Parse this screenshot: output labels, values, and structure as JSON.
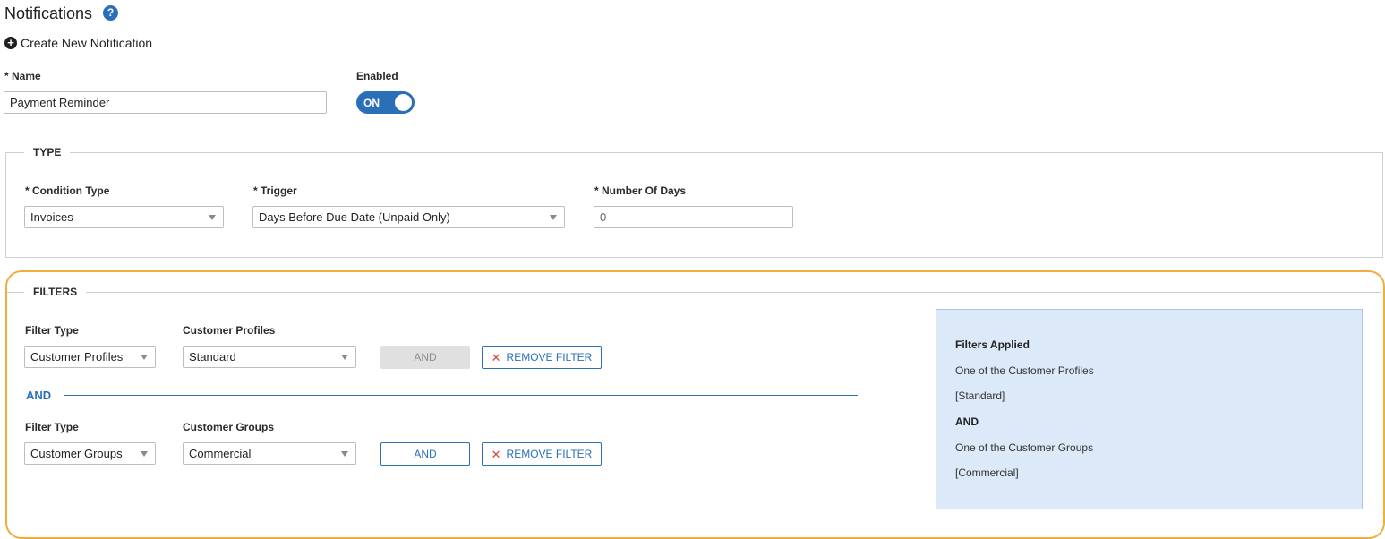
{
  "header": {
    "title": "Notifications",
    "help_icon": "?",
    "create_label": "Create New Notification"
  },
  "form": {
    "name_label": "* Name",
    "name_value": "Payment Reminder",
    "enabled_label": "Enabled",
    "enabled_state": "ON"
  },
  "type_section": {
    "legend": "TYPE",
    "condition_type_label": "* Condition Type",
    "condition_type_value": "Invoices",
    "trigger_label": "* Trigger",
    "trigger_value": "Days Before Due Date (Unpaid Only)",
    "days_label": "* Number Of Days",
    "days_value": "0"
  },
  "filters_section": {
    "legend": "FILTERS",
    "filters": [
      {
        "type_label": "Filter Type",
        "type_value": "Customer Profiles",
        "value_label": "Customer Profiles",
        "value": "Standard",
        "and_button": "AND",
        "remove_button": "REMOVE FILTER"
      },
      {
        "type_label": "Filter Type",
        "type_value": "Customer Groups",
        "value_label": "Customer Groups",
        "value": "Commercial",
        "and_button": "AND",
        "remove_button": "REMOVE FILTER"
      }
    ],
    "and_separator": "AND",
    "summary": {
      "title": "Filters Applied",
      "lines": [
        "One of the Customer Profiles",
        "[Standard]",
        "AND",
        "One of the Customer Groups",
        "[Commercial]"
      ]
    }
  },
  "colors": {
    "accent": "#2b6fb8",
    "highlight_border": "#f0ad3c",
    "summary_bg": "#dce9f8",
    "remove_x": "#d9433d"
  },
  "icons": {
    "help": "question-circle-icon",
    "create": "plus-circle-icon",
    "remove": "close-icon",
    "dropdown": "caret-down-icon"
  }
}
